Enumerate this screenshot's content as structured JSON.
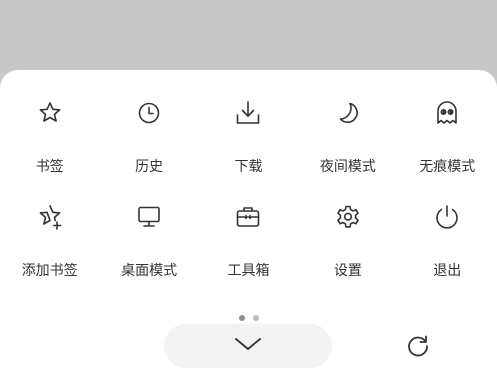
{
  "menu": {
    "items": [
      {
        "label": "书签",
        "icon": "star-icon"
      },
      {
        "label": "历史",
        "icon": "clock-icon"
      },
      {
        "label": "下载",
        "icon": "download-icon"
      },
      {
        "label": "夜间模式",
        "icon": "moon-icon"
      },
      {
        "label": "无痕模式",
        "icon": "ghost-icon"
      },
      {
        "label": "添加书签",
        "icon": "star-plus-icon"
      },
      {
        "label": "桌面模式",
        "icon": "monitor-icon"
      },
      {
        "label": "工具箱",
        "icon": "toolbox-icon"
      },
      {
        "label": "设置",
        "icon": "gear-icon"
      },
      {
        "label": "退出",
        "icon": "power-icon"
      }
    ]
  },
  "pager": {
    "pages": 2,
    "current": 1
  },
  "colors": {
    "overlay": "#c8c8c8",
    "sheet": "#ffffff",
    "icon": "#333333",
    "pill": "#f3f3f3"
  }
}
